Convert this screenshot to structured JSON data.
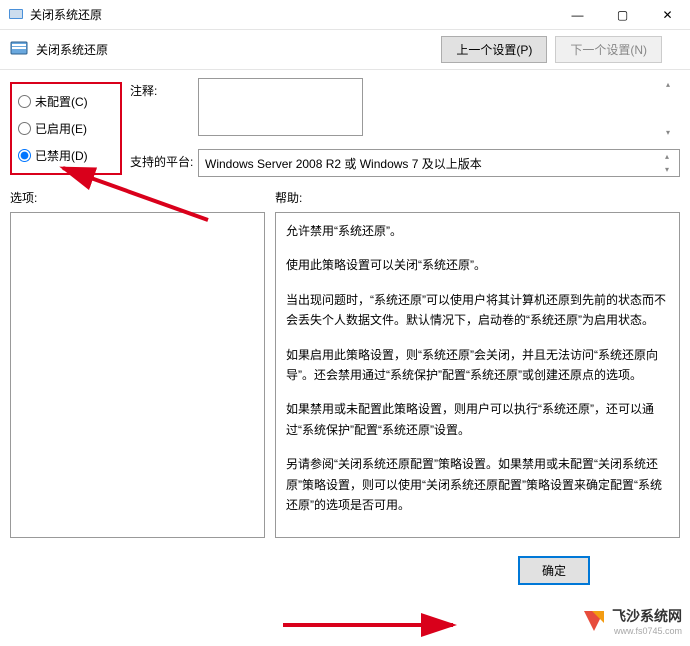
{
  "window": {
    "title": "关闭系统还原",
    "min": "—",
    "max": "▢",
    "close": "✕"
  },
  "subheader": {
    "title": "关闭系统还原",
    "prev_button": "上一个设置(P)",
    "next_button": "下一个设置(N)"
  },
  "radio": {
    "not_configured": "未配置(C)",
    "enabled": "已启用(E)",
    "disabled": "已禁用(D)",
    "selected": "disabled"
  },
  "fields": {
    "comment_label": "注释:",
    "comment_value": "",
    "platform_label": "支持的平台:",
    "platform_value": "Windows Server 2008 R2 或 Windows 7 及以上版本"
  },
  "sections": {
    "options_label": "选项:",
    "help_label": "帮助:"
  },
  "help_text": {
    "p1": "允许禁用“系统还原”。",
    "p2": "使用此策略设置可以关闭“系统还原”。",
    "p3": "当出现问题时，“系统还原”可以使用户将其计算机还原到先前的状态而不会丢失个人数据文件。默认情况下，启动卷的“系统还原”为启用状态。",
    "p4": "如果启用此策略设置，则“系统还原”会关闭，并且无法访问“系统还原向导”。还会禁用通过“系统保护”配置“系统还原”或创建还原点的选项。",
    "p5": "如果禁用或未配置此策略设置，则用户可以执行“系统还原”，还可以通过“系统保护”配置“系统还原”设置。",
    "p6": "另请参阅“关闭系统还原配置”策略设置。如果禁用或未配置“关闭系统还原”策略设置，则可以使用“关闭系统还原配置”策略设置来确定配置“系统还原”的选项是否可用。"
  },
  "buttons": {
    "ok": "确定"
  },
  "watermark": {
    "text": "飞沙系统网",
    "url": "www.fs0745.com"
  }
}
